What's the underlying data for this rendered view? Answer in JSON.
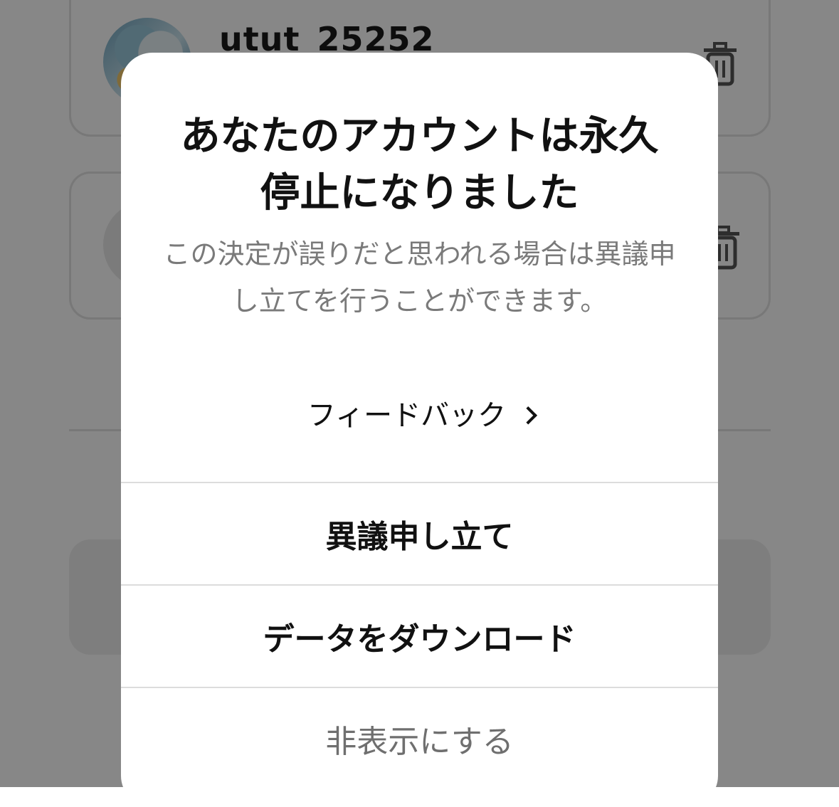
{
  "background": {
    "accounts": [
      {
        "username": "utut_25252"
      }
    ]
  },
  "dialog": {
    "title": "あなたのアカウントは永久停止になりました",
    "message": "この決定が誤りだと思われる場合は異議申し立てを行うことができます。",
    "feedback_label": "フィードバック",
    "actions": {
      "appeal": "異議申し立て",
      "download": "データをダウンロード",
      "hide": "非表示にする"
    }
  }
}
